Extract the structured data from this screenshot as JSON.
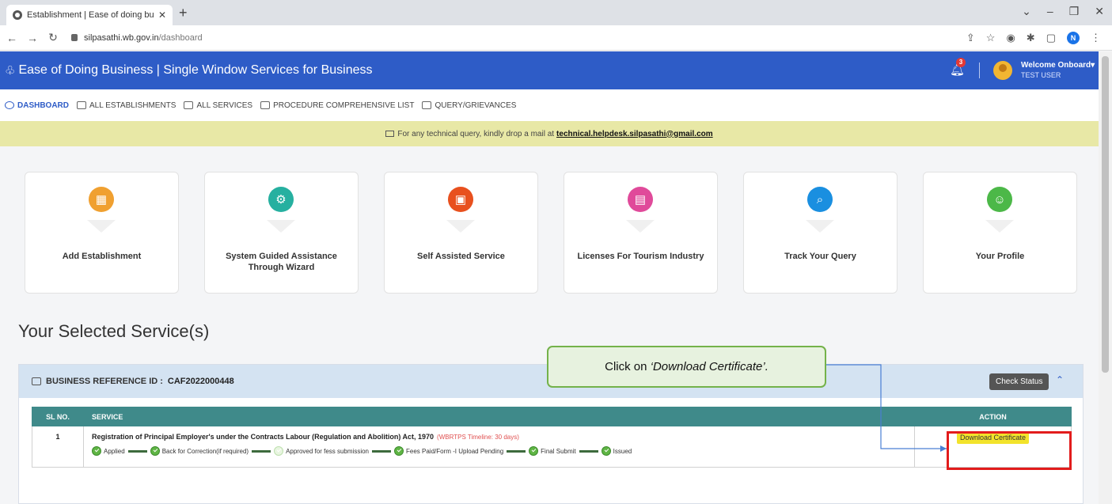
{
  "browser": {
    "tab_title": "Establishment | Ease of doing bu",
    "new_tab": "+",
    "url_domain": "silpasathi.wb.gov.in",
    "url_path": "/dashboard",
    "profile_initial": "N"
  },
  "header": {
    "title": "Ease of Doing Business | Single Window Services for Business",
    "notification_count": "3",
    "welcome": "Welcome Onboard",
    "user": "TEST USER"
  },
  "menu": [
    {
      "label": "DASHBOARD"
    },
    {
      "label": "ALL ESTABLISHMENTS"
    },
    {
      "label": "ALL SERVICES"
    },
    {
      "label": "PROCEDURE COMPREHENSIVE LIST"
    },
    {
      "label": "QUERY/GRIEVANCES"
    }
  ],
  "notice": {
    "text": "For any technical query, kindly drop a mail at",
    "email": "technical.helpdesk.silpasathi@gmail.com"
  },
  "cards": [
    {
      "label": "Add Establishment",
      "icon": "building-icon",
      "color": "#f0a030"
    },
    {
      "label": "System Guided Assistance Through Wizard",
      "icon": "gear-icon",
      "color": "#26b0a0"
    },
    {
      "label": "Self Assisted Service",
      "icon": "grid-icon",
      "color": "#e8501e"
    },
    {
      "label": "Licenses For Tourism Industry",
      "icon": "license-icon",
      "color": "#e04a9a"
    },
    {
      "label": "Track Your Query",
      "icon": "search-icon",
      "color": "#1a8fe0"
    },
    {
      "label": "Your Profile",
      "icon": "profile-icon",
      "color": "#4cb848"
    }
  ],
  "section_title": "Your Selected Service(s)",
  "reference": {
    "label": "BUSINESS REFERENCE ID :",
    "id": "CAF2022000448",
    "check_status": "Check Status"
  },
  "table": {
    "headers": {
      "sl": "SL NO.",
      "service": "SERVICE",
      "action": "ACTION"
    },
    "rows": [
      {
        "sl": "1",
        "service": "Registration of Principal Employer's under the Contracts Labour (Regulation and Abolition) Act, 1970",
        "timeline": "(WBRTPS Timeline: 30 days)",
        "steps": [
          "Applied",
          "Back for Correction(if required)",
          "Approved for fess submission",
          "Fees Paid/Form -I Upload Pending",
          "Final Submit",
          "Issued"
        ],
        "action": "Download Certificate"
      }
    ]
  },
  "callout": {
    "prefix": "Click on ",
    "emphasis": "‘Download Certificate’."
  }
}
